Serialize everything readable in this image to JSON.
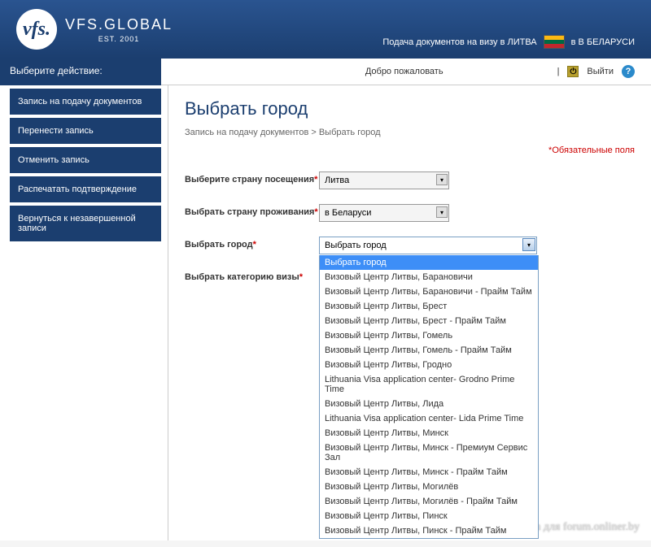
{
  "header": {
    "brand_name": "VFS.GLOBAL",
    "brand_est": "EST. 2001",
    "logo_text": "vfs.",
    "submit_text": "Подача документов на визу в ЛИТВА",
    "in_country": "в В БЕЛАРУСИ"
  },
  "welcome": {
    "greeting": "Добро пожаловать",
    "logout": "Выйти"
  },
  "sidebar": {
    "header": "Выберите действие:",
    "items": [
      "Запись на подачу документов",
      "Перенести запись",
      "Отменить запись",
      "Распечатать подтверждение",
      "Вернуться к незавершенной записи"
    ]
  },
  "page": {
    "title": "Выбрать город",
    "breadcrumb": "Запись на подачу документов  >  Выбрать город",
    "required_note": "Обязательные поля"
  },
  "form": {
    "country_visit": {
      "label": "Выберите страну посещения",
      "value": "Литва"
    },
    "country_residence": {
      "label": "Выбрать страну проживания",
      "value": "в Беларуси"
    },
    "city": {
      "label": "Выбрать город",
      "value": "Выбрать город"
    },
    "visa_category": {
      "label": "Выбрать категорию визы"
    }
  },
  "city_options": [
    "Выбрать город",
    "Визовый Центр Литвы, Барановичи",
    "Визовый Центр Литвы, Барановичи - Прайм Тайм",
    "Визовый Центр Литвы, Брест",
    "Визовый Центр Литвы, Брест - Прайм Тайм",
    "Визовый Центр Литвы, Гомель",
    "Визовый Центр Литвы, Гомель - Прайм Тайм",
    "Визовый Центр Литвы, Гродно",
    "Lithuania Visa application center- Grodno Prime Time",
    "Визовый Центр Литвы, Лида",
    "Lithuania Visa application center- Lida Prime Time",
    "Визовый Центр Литвы, Минск",
    "Визовый Центр Литвы, Минск - Премиум Сервис Зал",
    "Визовый Центр Литвы, Минск - Прайм Тайм",
    "Визовый Центр Литвы, Могилёв",
    "Визовый Центр Литвы, Могилёв - Прайм Тайм",
    "Визовый Центр Литвы, Пинск",
    "Визовый Центр Литвы, Пинск - Прайм Тайм"
  ],
  "watermark": "Olgamikh для forum.onliner.by"
}
